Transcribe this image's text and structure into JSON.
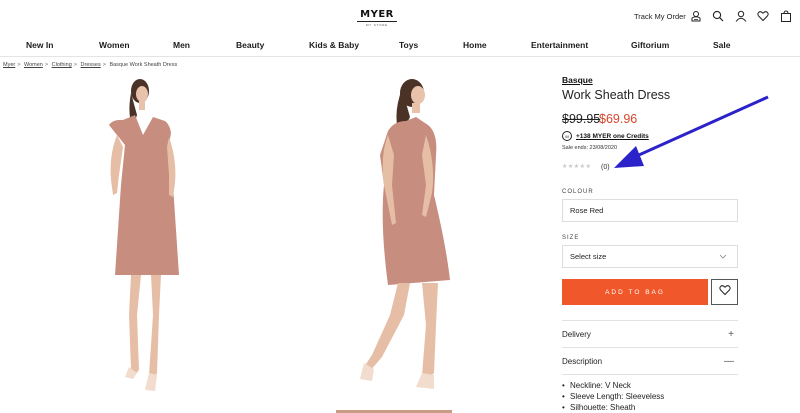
{
  "header": {
    "logo_text": "MYER",
    "logo_sub": "MY STORE",
    "track_order": "Track My Order",
    "icons": [
      "track-order-icon",
      "search-icon",
      "account-icon",
      "heart-icon",
      "bag-icon"
    ]
  },
  "nav": {
    "items": [
      "New In",
      "Women",
      "Men",
      "Beauty",
      "Kids & Baby",
      "Toys",
      "Home",
      "Entertainment",
      "Giftorium",
      "Sale"
    ]
  },
  "breadcrumb": [
    "Myer",
    "Women",
    "Clothing",
    "Dresses",
    "Basque Work Sheath Dress"
  ],
  "product": {
    "brand": "Basque",
    "title": "Work Sheath Dress",
    "price_original": "$99.95",
    "price_sale": "$69.96",
    "credits": "+138 MYER one Credits",
    "credits_badge": "M",
    "sale_ends": "Sale ends: 23/08/2020",
    "rating_stars": "★★★★★",
    "rating_count": "(0)",
    "colour_label": "COLOUR",
    "colour_value": "Rose Red",
    "size_label": "SIZE",
    "size_value": "Select size",
    "add_to_bag": "ADD TO BAG",
    "delivery": "Delivery",
    "delivery_sign": "+",
    "description": "Description",
    "description_sign": "—",
    "description_items": [
      "Neckline: V Neck",
      "Sleeve Length: Sleeveless",
      "Silhouette: Sheath"
    ]
  },
  "colors": {
    "accent": "#f0572b",
    "sale_price": "#d9452b",
    "annotation_arrow": "#2b22c9",
    "dress": "#c78d7e"
  }
}
